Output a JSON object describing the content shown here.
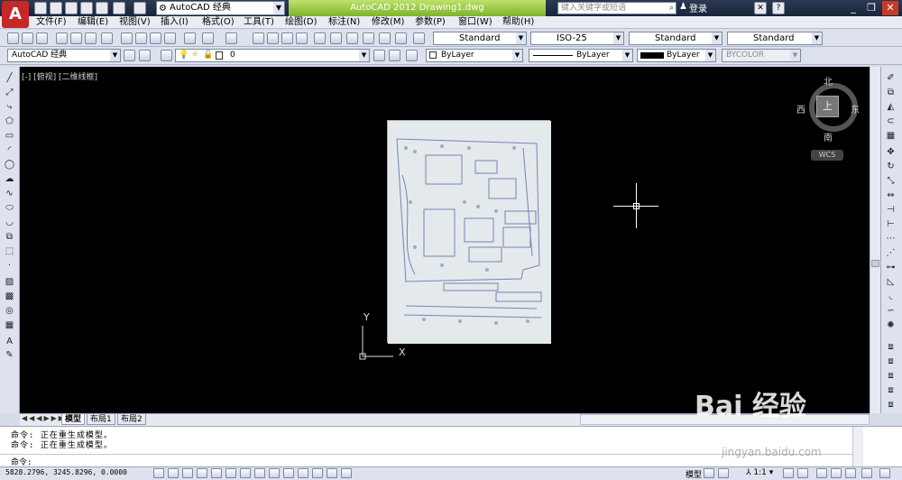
{
  "app": {
    "workspace": "AutoCAD 经典",
    "title": "AutoCAD 2012    Drawing1.dwg",
    "search_placeholder": "键入关键字或短语",
    "login": "登录"
  },
  "menus": [
    "文件(F)",
    "编辑(E)",
    "视图(V)",
    "插入(I)",
    "格式(O)",
    "工具(T)",
    "绘图(D)",
    "标注(N)",
    "修改(M)",
    "参数(P)",
    "窗口(W)",
    "帮助(H)"
  ],
  "styles": {
    "text_style": "Standard",
    "dim_style": "ISO-25",
    "table_style": "Standard",
    "multileader_style": "Standard"
  },
  "layers": {
    "workspace": "AutoCAD 经典",
    "current_layer": "0",
    "color": "ByLayer",
    "linetype": "ByLayer",
    "lineweight": "ByLayer",
    "plot_style": "BYCOLOR"
  },
  "viewport_label": "[-] [俯视] [二维线框]",
  "viewcube": {
    "north": "北",
    "south": "南",
    "east": "东",
    "west": "西",
    "top": "上",
    "wcs": "WCS"
  },
  "ucs": {
    "x": "X",
    "y": "Y"
  },
  "tabs": [
    "模型",
    "布局1",
    "布局2"
  ],
  "commands": {
    "history": [
      "命令:  正在重生成模型。",
      "命令:  正在重生成模型。"
    ],
    "prompt": "命令:"
  },
  "status": {
    "coordinates": "5828.2796, 3245.8296, 0.0000",
    "model_label": "模型",
    "annotation_scale": "1:1"
  },
  "watermark": {
    "text": "Bai 经验",
    "url": "jingyan.baidu.com"
  }
}
